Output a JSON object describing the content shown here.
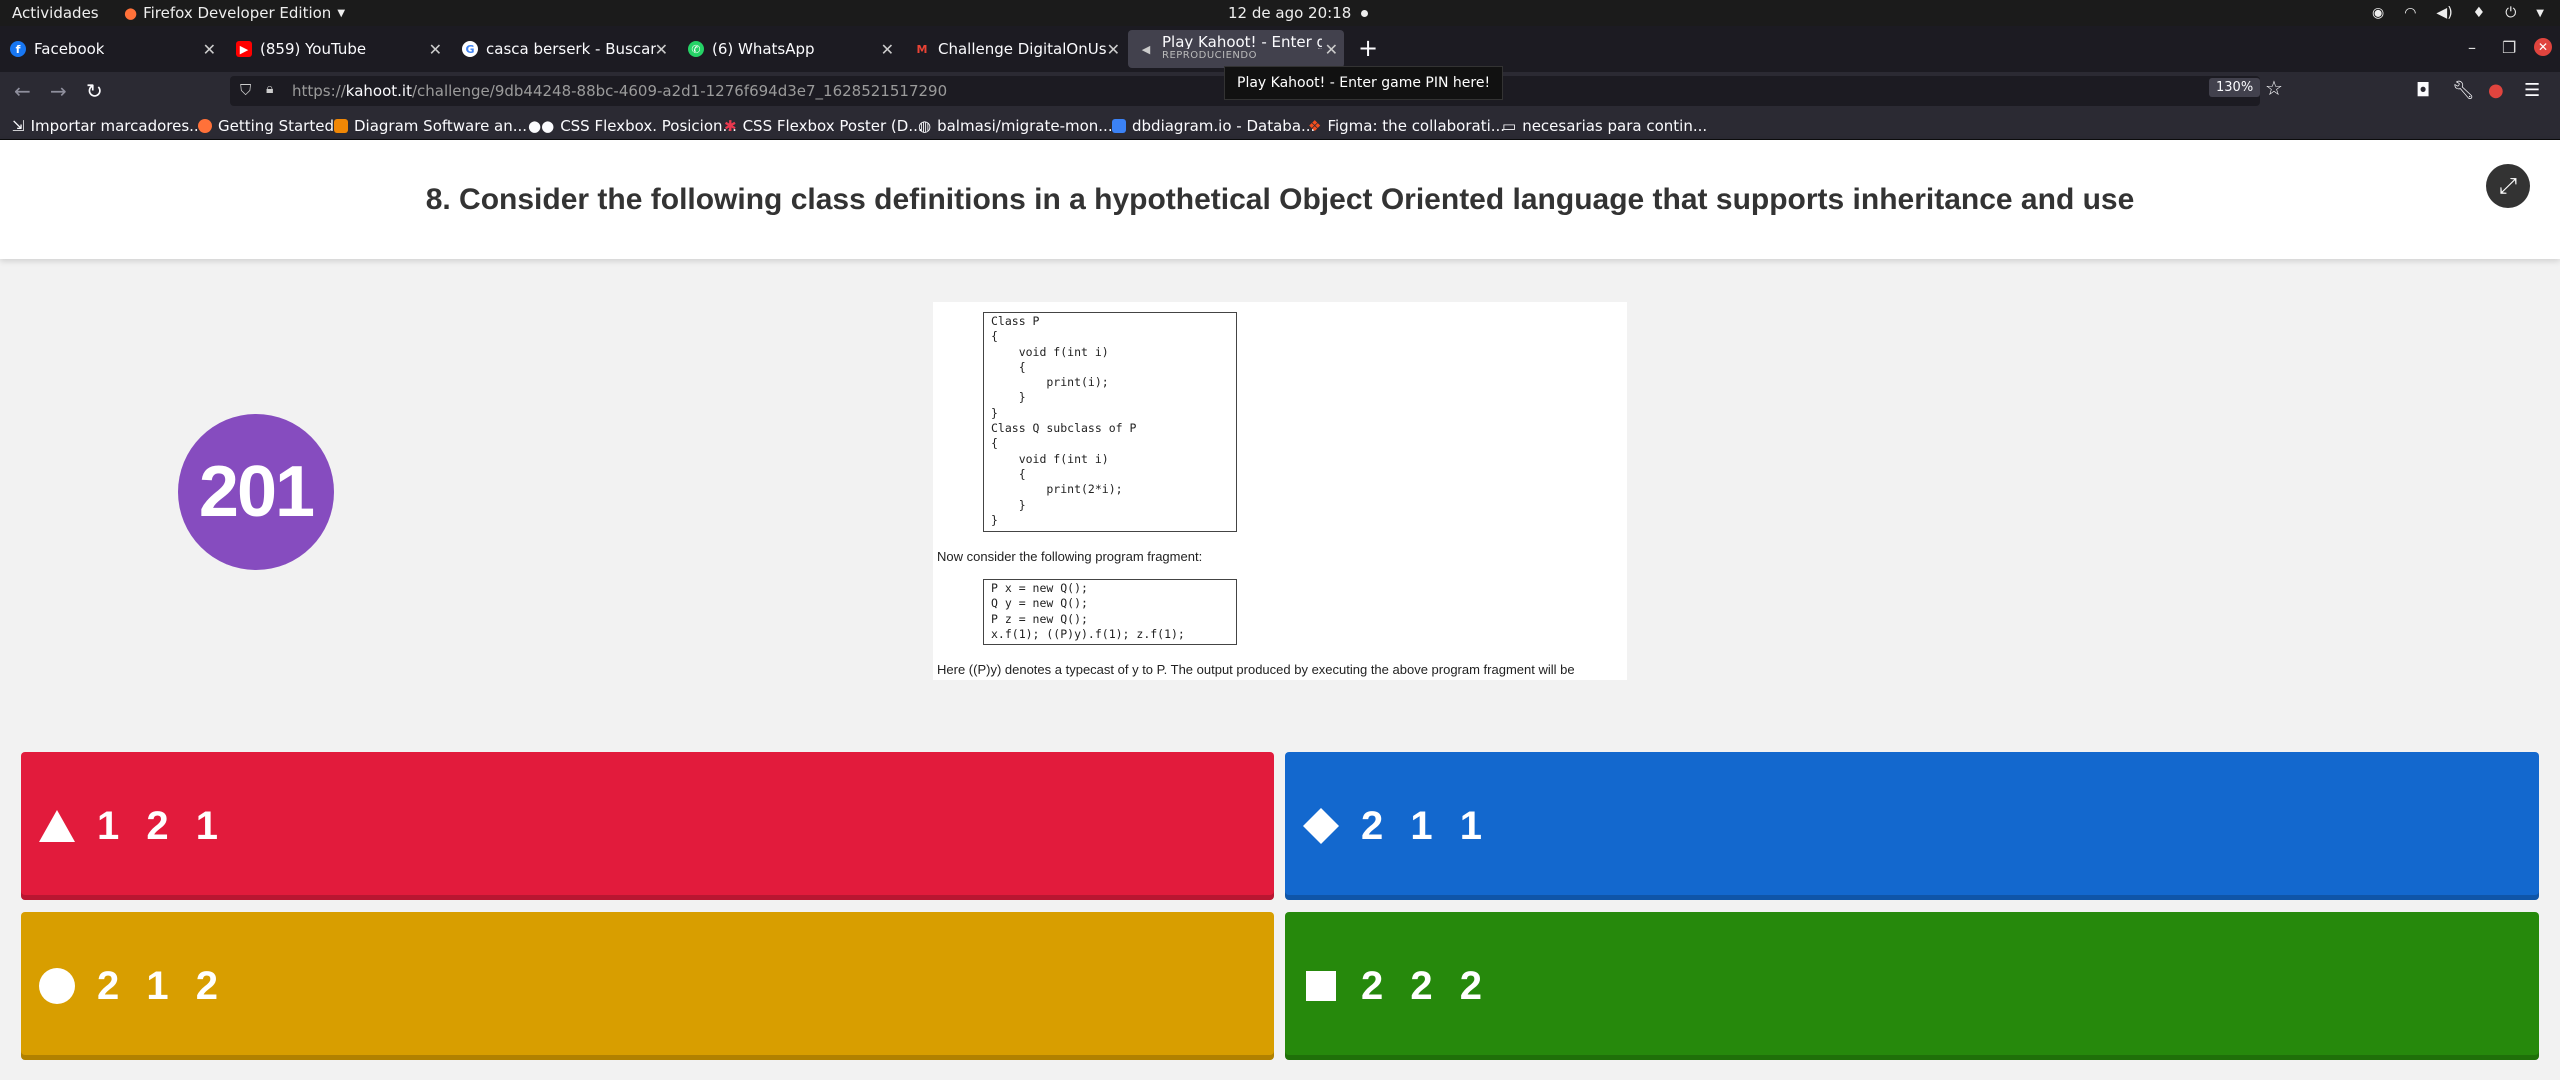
{
  "system_bar": {
    "activities": "Actividades",
    "app_name": "Firefox Developer Edition",
    "clock": "12 de ago  20:18"
  },
  "tabs": [
    {
      "label": "Facebook",
      "icon": "facebook-icon",
      "color": "#1877f2"
    },
    {
      "label": "(859) YouTube",
      "icon": "youtube-icon",
      "color": "#ff0000"
    },
    {
      "label": "casca berserk - Buscar co",
      "icon": "google-icon",
      "color": "#ffffff"
    },
    {
      "label": "(6) WhatsApp",
      "icon": "whatsapp-icon",
      "color": "#25d366"
    },
    {
      "label": "Challenge DigitalOnUs - I",
      "icon": "gmail-icon",
      "color": "#ea4335"
    },
    {
      "label": "Play Kahoot! - Enter gam",
      "subtitle": "REPRODUCIENDO",
      "icon": "speaker-icon",
      "color": "#42414d"
    }
  ],
  "tooltip": "Play Kahoot! - Enter game PIN here!",
  "url": {
    "prefix": "https://",
    "host": "kahoot.it",
    "path": "/challenge/9db44248-88bc-4609-a2d1-1276f694d3e7_1628521517290"
  },
  "zoom": "130%",
  "bookmarks": [
    {
      "label": "Importar marcadores...",
      "color": "#cccccc"
    },
    {
      "label": "Getting Started",
      "color": "#ff7139"
    },
    {
      "label": "Diagram Software an...",
      "color": "#f08705"
    },
    {
      "label": "CSS Flexbox. Posicion...",
      "color": "#ffffff"
    },
    {
      "label": "CSS Flexbox Poster (D...",
      "color": "#e8384f"
    },
    {
      "label": "balmasi/migrate-mon...",
      "color": "#ffffff"
    },
    {
      "label": "dbdiagram.io - Databa...",
      "color": "#3b82f6"
    },
    {
      "label": "Figma: the collaborati...",
      "color": "#f24e1e"
    },
    {
      "label": "necesarias para contin...",
      "color": "#cccccc"
    }
  ],
  "question": {
    "title": "8. Consider the following class definitions in a hypothetical Object Oriented language that supports inheritance and use",
    "timer": "201",
    "code_block_1": "Class P\n{\n    void f(int i)\n    {\n        print(i);\n    }\n}\nClass Q subclass of P\n{\n    void f(int i)\n    {\n        print(2*i);\n    }\n}",
    "middle_text": "Now consider the following program fragment:",
    "code_block_2": "P x = new Q();\nQ y = new Q();\nP z = new Q();\nx.f(1); ((P)y).f(1); z.f(1);",
    "bottom_text": "Here ((P)y) denotes a typecast of y to P. The output produced by executing the above program fragment will be"
  },
  "answers": [
    {
      "label": "1 2 1",
      "shape": "triangle",
      "color": "#e21b3c"
    },
    {
      "label": "2 1 1",
      "shape": "diamond",
      "color": "#1368ce"
    },
    {
      "label": "2 1 2",
      "shape": "circle",
      "color": "#d89e00"
    },
    {
      "label": "2 2 2",
      "shape": "square",
      "color": "#26890c"
    }
  ]
}
